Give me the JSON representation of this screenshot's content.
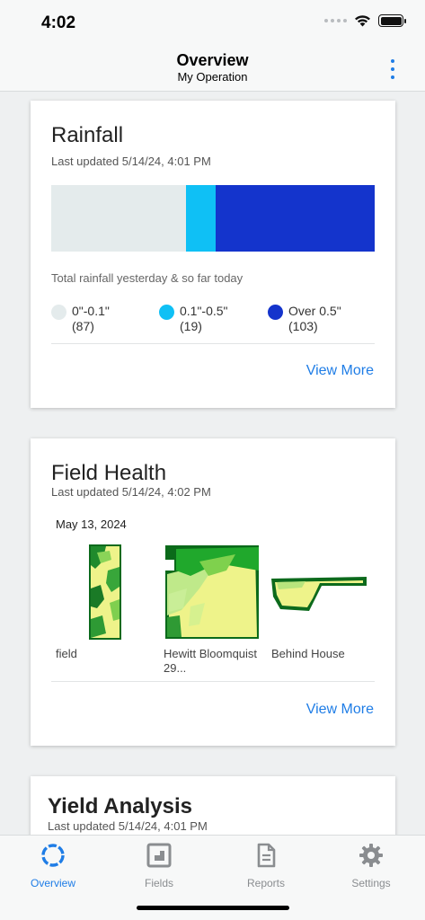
{
  "status": {
    "time": "4:02"
  },
  "header": {
    "title": "Overview",
    "subtitle": "My Operation",
    "more_icon": "more-vertical-icon"
  },
  "rainfall": {
    "title": "Rainfall",
    "updated": "Last updated 5/14/24, 4:01 PM",
    "caption": "Total rainfall yesterday & so far today",
    "segments": [
      {
        "label": "0\"-0.1\"",
        "count": "(87)",
        "value": 87,
        "color": "#e4ebec"
      },
      {
        "label": "0.1\"-0.5\"",
        "count": "(19)",
        "value": 19,
        "color": "#0fc0f5"
      },
      {
        "label": "Over 0.5\"",
        "count": "(103)",
        "value": 103,
        "color": "#1434cc"
      }
    ],
    "view_more": "View More"
  },
  "field_health": {
    "title": "Field Health",
    "updated": "Last updated 5/14/24, 4:02 PM",
    "date": "May 13, 2024",
    "fields": [
      {
        "name": "field"
      },
      {
        "name": "Hewitt Bloomquist 29..."
      },
      {
        "name": "Behind House"
      }
    ],
    "view_more": "View More"
  },
  "yield_analysis": {
    "title": "Yield Analysis",
    "updated": "Last updated 5/14/24, 4:01 PM"
  },
  "tabs": [
    {
      "label": "Overview",
      "icon": "overview-ring-icon",
      "active": true
    },
    {
      "label": "Fields",
      "icon": "fields-map-icon",
      "active": false
    },
    {
      "label": "Reports",
      "icon": "document-icon",
      "active": false
    },
    {
      "label": "Settings",
      "icon": "gear-icon",
      "active": false
    }
  ],
  "colors": {
    "accent": "#1f7de6",
    "tab_inactive": "#8a8d90"
  }
}
